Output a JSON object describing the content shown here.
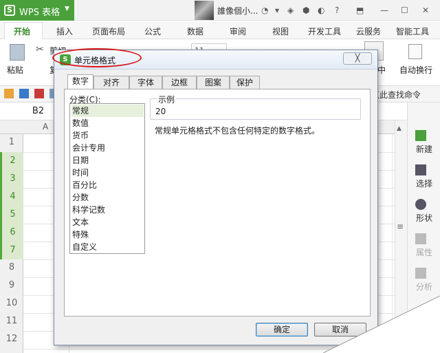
{
  "titlebar": {
    "app_title": "WPS 表格",
    "app_logo_letter": "S",
    "user_name": "誰像個小..."
  },
  "ribbon_tabs": [
    "开始",
    "插入",
    "页面布局",
    "公式",
    "数据",
    "审阅",
    "视图",
    "开发工具",
    "云服务",
    "智能工具"
  ],
  "ribbon": {
    "paste_label": "粘贴",
    "cut_label": "剪切",
    "copy_label": "复",
    "font_size": "11",
    "middle_label": "中",
    "autowrap_label": "自动换行"
  },
  "quickbar": {
    "find_command": "点此查找命令"
  },
  "formula_bar": {
    "cell_ref": "B2"
  },
  "grid": {
    "column_label": "A",
    "rows": [
      "1",
      "2",
      "3",
      "4",
      "5",
      "6",
      "7",
      "8",
      "9",
      "10",
      "11",
      "12"
    ],
    "selected_rows": [
      2,
      3,
      4,
      5,
      6,
      7
    ]
  },
  "right_panel": [
    {
      "label": "新建",
      "icon": "new-doc-icon",
      "enabled": true
    },
    {
      "label": "选择",
      "icon": "select-icon",
      "enabled": true
    },
    {
      "label": "形状",
      "icon": "shape-icon",
      "enabled": true
    },
    {
      "label": "属性",
      "icon": "properties-icon",
      "enabled": false
    },
    {
      "label": "分析",
      "icon": "analysis-icon",
      "enabled": false
    }
  ],
  "dialog": {
    "title": "单元格格式",
    "close_label": "╳",
    "tabs": [
      "数字",
      "对齐",
      "字体",
      "边框",
      "图案",
      "保护"
    ],
    "active_tab": "数字",
    "category_label": "分类(C):",
    "categories": [
      "常规",
      "数值",
      "货币",
      "会计专用",
      "日期",
      "时间",
      "百分比",
      "分数",
      "科学记数",
      "文本",
      "特殊",
      "自定义"
    ],
    "selected_category": "常规",
    "sample_label": "示例",
    "sample_value": "20",
    "description": "常规单元格格式不包含任何特定的数字格式。",
    "ok_label": "确定",
    "cancel_label": "取消"
  },
  "colors": {
    "accent": "#4aa03a",
    "highlight_oval": "#d81818"
  }
}
